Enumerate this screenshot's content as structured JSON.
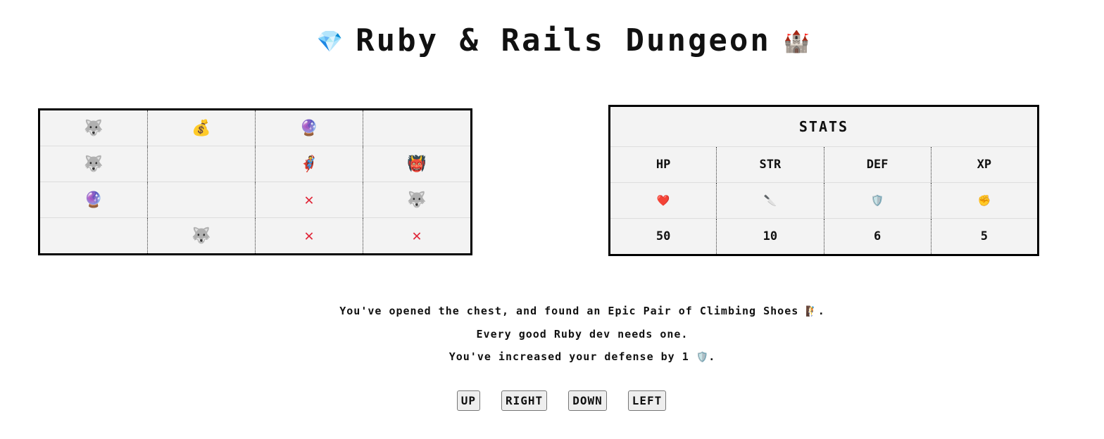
{
  "header": {
    "title": "Ruby & Rails Dungeon",
    "left_icon": "💎",
    "right_icon": "🏰"
  },
  "dungeon": {
    "rows": [
      [
        {
          "type": "wolf",
          "glyph": "🐺"
        },
        {
          "type": "money-bag",
          "glyph": "💰"
        },
        {
          "type": "crystal-ball",
          "glyph": "🔮"
        },
        {
          "type": "empty",
          "glyph": ""
        }
      ],
      [
        {
          "type": "wolf",
          "glyph": "🐺"
        },
        {
          "type": "empty",
          "glyph": ""
        },
        {
          "type": "player",
          "glyph": "🦸"
        },
        {
          "type": "ogre",
          "glyph": "👹"
        }
      ],
      [
        {
          "type": "crystal-ball",
          "glyph": "🔮"
        },
        {
          "type": "empty",
          "glyph": ""
        },
        {
          "type": "visited-x",
          "glyph": "✕"
        },
        {
          "type": "wolf",
          "glyph": "🐺"
        }
      ],
      [
        {
          "type": "empty",
          "glyph": ""
        },
        {
          "type": "wolf",
          "glyph": "🐺"
        },
        {
          "type": "visited-x",
          "glyph": "✕"
        },
        {
          "type": "visited-x",
          "glyph": "✕"
        }
      ]
    ]
  },
  "stats": {
    "title": "STATS",
    "columns": [
      {
        "label": "HP",
        "icon": "❤️",
        "icon_name": "heart-icon",
        "value": "50"
      },
      {
        "label": "STR",
        "icon": "🔪",
        "icon_name": "knife-icon",
        "value": "10"
      },
      {
        "label": "DEF",
        "icon": "🛡️",
        "icon_name": "shield-icon",
        "value": "6"
      },
      {
        "label": "XP",
        "icon": "✊",
        "icon_name": "fist-icon",
        "value": "5"
      }
    ]
  },
  "message": {
    "line1": "You've opened the chest, and found an Epic Pair of Climbing Shoes",
    "line1_icon": "🧗",
    "line1_end": ".",
    "line2": "Every good Ruby dev needs one.",
    "line3": "You've increased your defense by 1",
    "line3_icon": "🛡️",
    "line3_end": "."
  },
  "controls": {
    "up": "UP",
    "right": "RIGHT",
    "down": "DOWN",
    "left": "LEFT"
  },
  "colors": {
    "grid_background": "#f3f3f3",
    "border": "#000000",
    "visited_x": "#e0283a",
    "button_background": "#eeeeee"
  }
}
